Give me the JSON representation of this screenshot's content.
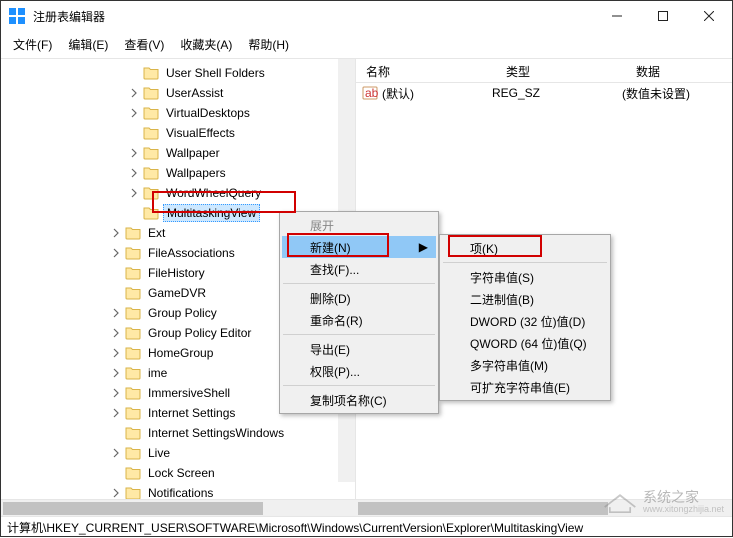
{
  "window": {
    "title": "注册表编辑器",
    "controls": {
      "min": "—",
      "max": "☐",
      "close": "✕"
    }
  },
  "menu": {
    "file": "文件(F)",
    "edit": "编辑(E)",
    "view": "查看(V)",
    "favorites": "收藏夹(A)",
    "help": "帮助(H)"
  },
  "tree": [
    {
      "depth": 7,
      "label": "User Shell Folders",
      "toggle": "none"
    },
    {
      "depth": 7,
      "label": "UserAssist",
      "toggle": "closed"
    },
    {
      "depth": 7,
      "label": "VirtualDesktops",
      "toggle": "closed"
    },
    {
      "depth": 7,
      "label": "VisualEffects",
      "toggle": "none"
    },
    {
      "depth": 7,
      "label": "Wallpaper",
      "toggle": "closed"
    },
    {
      "depth": 7,
      "label": "Wallpapers",
      "toggle": "closed"
    },
    {
      "depth": 7,
      "label": "WordWheelQuery",
      "toggle": "closed"
    },
    {
      "depth": 7,
      "label": "MultitaskingView",
      "toggle": "none",
      "selected": true,
      "highlighted": true
    },
    {
      "depth": 6,
      "label": "Ext",
      "toggle": "closed"
    },
    {
      "depth": 6,
      "label": "FileAssociations",
      "toggle": "closed"
    },
    {
      "depth": 6,
      "label": "FileHistory",
      "toggle": "none"
    },
    {
      "depth": 6,
      "label": "GameDVR",
      "toggle": "none"
    },
    {
      "depth": 6,
      "label": "Group Policy",
      "toggle": "closed"
    },
    {
      "depth": 6,
      "label": "Group Policy Editor",
      "toggle": "closed"
    },
    {
      "depth": 6,
      "label": "HomeGroup",
      "toggle": "closed"
    },
    {
      "depth": 6,
      "label": "ime",
      "toggle": "closed"
    },
    {
      "depth": 6,
      "label": "ImmersiveShell",
      "toggle": "closed"
    },
    {
      "depth": 6,
      "label": "Internet Settings",
      "toggle": "closed"
    },
    {
      "depth": 6,
      "label": "Internet SettingsWindows",
      "toggle": "none"
    },
    {
      "depth": 6,
      "label": "Live",
      "toggle": "closed"
    },
    {
      "depth": 6,
      "label": "Lock Screen",
      "toggle": "none"
    },
    {
      "depth": 6,
      "label": "Notifications",
      "toggle": "closed"
    }
  ],
  "list": {
    "headers": {
      "name": "名称",
      "type": "类型",
      "data": "数据"
    },
    "rows": [
      {
        "name": "(默认)",
        "type": "REG_SZ",
        "data": "(数值未设置)"
      }
    ]
  },
  "context_menu_1": {
    "expand": "展开",
    "new": "新建(N)",
    "find": "查找(F)...",
    "delete": "删除(D)",
    "rename": "重命名(R)",
    "export": "导出(E)",
    "permissions": "权限(P)...",
    "copy_key_name": "复制项名称(C)"
  },
  "context_menu_2": {
    "key": "项(K)",
    "string": "字符串值(S)",
    "binary": "二进制值(B)",
    "dword": "DWORD (32 位)值(D)",
    "qword": "QWORD (64 位)值(Q)",
    "multi_string": "多字符串值(M)",
    "expand_string": "可扩充字符串值(E)"
  },
  "statusbar": {
    "path": "计算机\\HKEY_CURRENT_USER\\SOFTWARE\\Microsoft\\Windows\\CurrentVersion\\Explorer\\MultitaskingView"
  },
  "watermark": {
    "line1": "系统之家",
    "line2": "www.xitongzhijia.net"
  }
}
